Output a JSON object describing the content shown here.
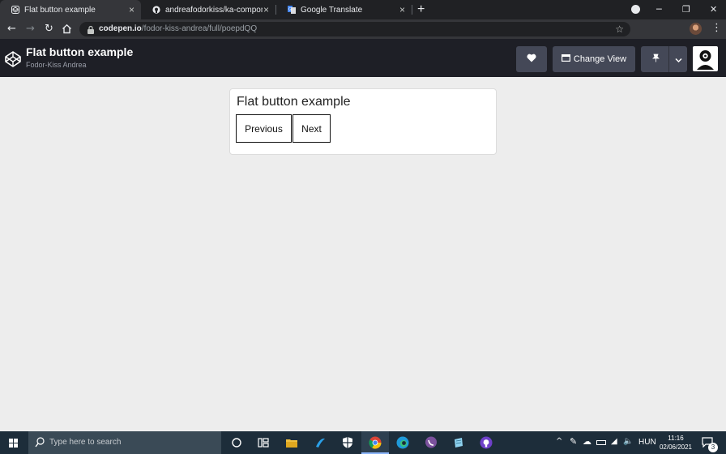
{
  "browser": {
    "tabs": [
      {
        "title": "Flat button example",
        "icon": "codepen-icon",
        "active": true
      },
      {
        "title": "andreafodorkiss/ka-components",
        "icon": "github-icon",
        "active": false
      },
      {
        "title": "Google Translate",
        "icon": "google-translate-icon",
        "active": false
      }
    ],
    "close_glyph": "×",
    "new_tab_glyph": "+",
    "url_domain": "codepen.io",
    "url_path": "/fodor-kiss-andrea/full/poepdQQ"
  },
  "codepen": {
    "title": "Flat button example",
    "author": "Fodor-Kiss Andrea",
    "change_view_label": "Change View"
  },
  "content": {
    "heading": "Flat button example",
    "buttons": {
      "previous": "Previous",
      "next": "Next"
    }
  },
  "taskbar": {
    "search_placeholder": "Type here to search",
    "language": "HUN",
    "time": "11:16",
    "date": "02/06/2021",
    "notification_count": "3"
  },
  "colors": {
    "page_background": "#ededed",
    "codepen_header": "#1e1f26",
    "codepen_button": "#444857",
    "browser_frame": "#202124",
    "taskbar": "#1d2d3a"
  }
}
